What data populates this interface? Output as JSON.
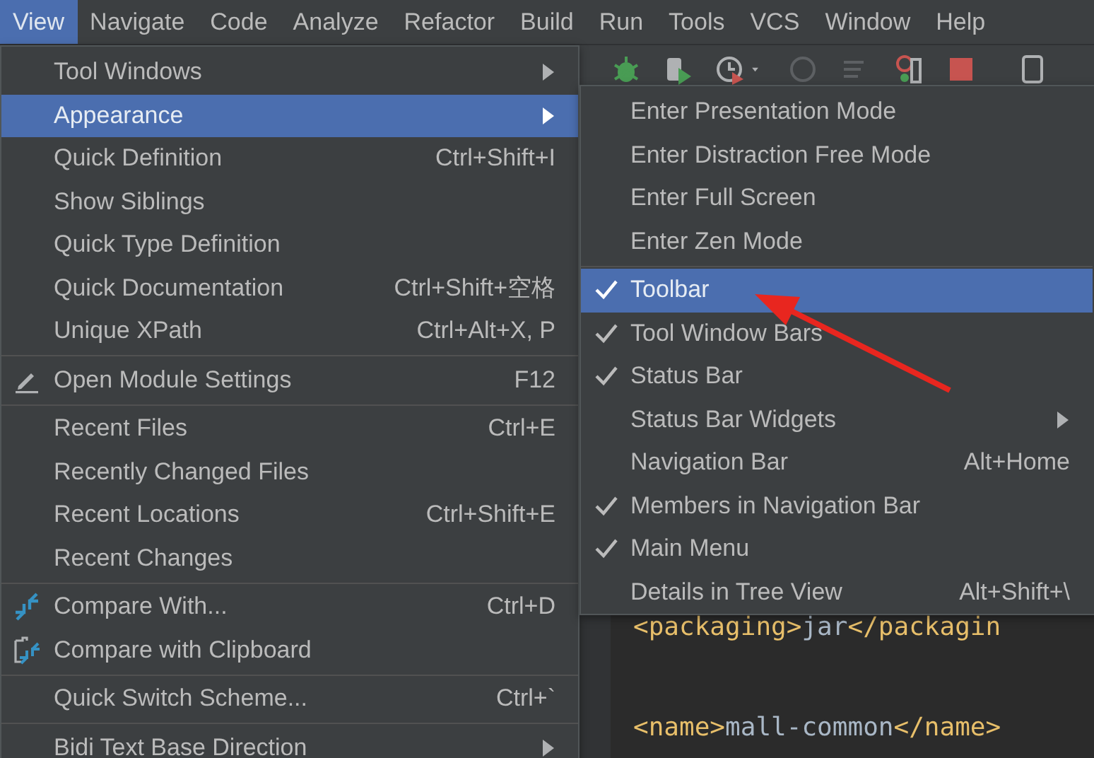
{
  "menubar": [
    {
      "label": "View",
      "selected": true
    },
    {
      "label": "Navigate",
      "selected": false
    },
    {
      "label": "Code",
      "selected": false
    },
    {
      "label": "Analyze",
      "selected": false
    },
    {
      "label": "Refactor",
      "selected": false
    },
    {
      "label": "Build",
      "selected": false
    },
    {
      "label": "Run",
      "selected": false
    },
    {
      "label": "Tools",
      "selected": false
    },
    {
      "label": "VCS",
      "selected": false
    },
    {
      "label": "Window",
      "selected": false
    },
    {
      "label": "Help",
      "selected": false
    }
  ],
  "view_menu": [
    {
      "kind": "item",
      "label": "Tool Windows",
      "submenu": true,
      "selected": false
    },
    {
      "kind": "item",
      "label": "Appearance",
      "submenu": true,
      "selected": true
    },
    {
      "kind": "item",
      "label": "Quick Definition",
      "shortcut": "Ctrl+Shift+I",
      "selected": false
    },
    {
      "kind": "item",
      "label": "Show Siblings",
      "selected": false
    },
    {
      "kind": "item",
      "label": "Quick Type Definition",
      "selected": false
    },
    {
      "kind": "item",
      "label": "Quick Documentation",
      "shortcut": "Ctrl+Shift+空格",
      "selected": false
    },
    {
      "kind": "item",
      "label": "Unique XPath",
      "shortcut": "Ctrl+Alt+X, P",
      "selected": false
    },
    {
      "kind": "separator"
    },
    {
      "kind": "item",
      "label": "Open Module Settings",
      "shortcut": "F12",
      "selected": false
    },
    {
      "kind": "separator"
    },
    {
      "kind": "item",
      "label": "Recent Files",
      "shortcut": "Ctrl+E",
      "selected": false
    },
    {
      "kind": "item",
      "label": "Recently Changed Files",
      "selected": false
    },
    {
      "kind": "item",
      "label": "Recent Locations",
      "shortcut": "Ctrl+Shift+E",
      "selected": false
    },
    {
      "kind": "item",
      "label": "Recent Changes",
      "selected": false
    },
    {
      "kind": "separator"
    },
    {
      "kind": "item",
      "label": "Compare With...",
      "shortcut": "Ctrl+D",
      "selected": false
    },
    {
      "kind": "item",
      "label": "Compare with Clipboard",
      "selected": false
    },
    {
      "kind": "separator"
    },
    {
      "kind": "item",
      "label": "Quick Switch Scheme...",
      "shortcut": "Ctrl+`",
      "selected": false
    },
    {
      "kind": "separator"
    },
    {
      "kind": "item",
      "label": "Bidi Text Base Direction",
      "submenu": true,
      "selected": false
    }
  ],
  "appearance_menu": [
    {
      "kind": "item",
      "label": "Enter Presentation Mode",
      "checked": false,
      "selected": false
    },
    {
      "kind": "item",
      "label": "Enter Distraction Free Mode",
      "checked": false,
      "selected": false
    },
    {
      "kind": "item",
      "label": "Enter Full Screen",
      "checked": false,
      "selected": false
    },
    {
      "kind": "item",
      "label": "Enter Zen Mode",
      "checked": false,
      "selected": false
    },
    {
      "kind": "separator"
    },
    {
      "kind": "item",
      "label": "Toolbar",
      "checked": true,
      "selected": true
    },
    {
      "kind": "item",
      "label": "Tool Window Bars",
      "checked": true,
      "selected": false
    },
    {
      "kind": "item",
      "label": "Status Bar",
      "checked": true,
      "selected": false
    },
    {
      "kind": "item",
      "label": "Status Bar Widgets",
      "checked": false,
      "submenu": true,
      "selected": false
    },
    {
      "kind": "item",
      "label": "Navigation Bar",
      "shortcut": "Alt+Home",
      "checked": false,
      "selected": false
    },
    {
      "kind": "item",
      "label": "Members in Navigation Bar",
      "checked": true,
      "selected": false
    },
    {
      "kind": "item",
      "label": "Main Menu",
      "checked": true,
      "selected": false
    },
    {
      "kind": "item",
      "label": "Details in Tree View",
      "shortcut": "Alt+Shift+\\",
      "checked": false,
      "selected": false
    }
  ],
  "editor": {
    "lines": [
      {
        "tag_open": "<packaging>",
        "text": "jar",
        "tag_close": "</packagin"
      },
      {
        "tag_open": "<name>",
        "text": "mall-common",
        "tag_close": "</name>"
      }
    ]
  }
}
